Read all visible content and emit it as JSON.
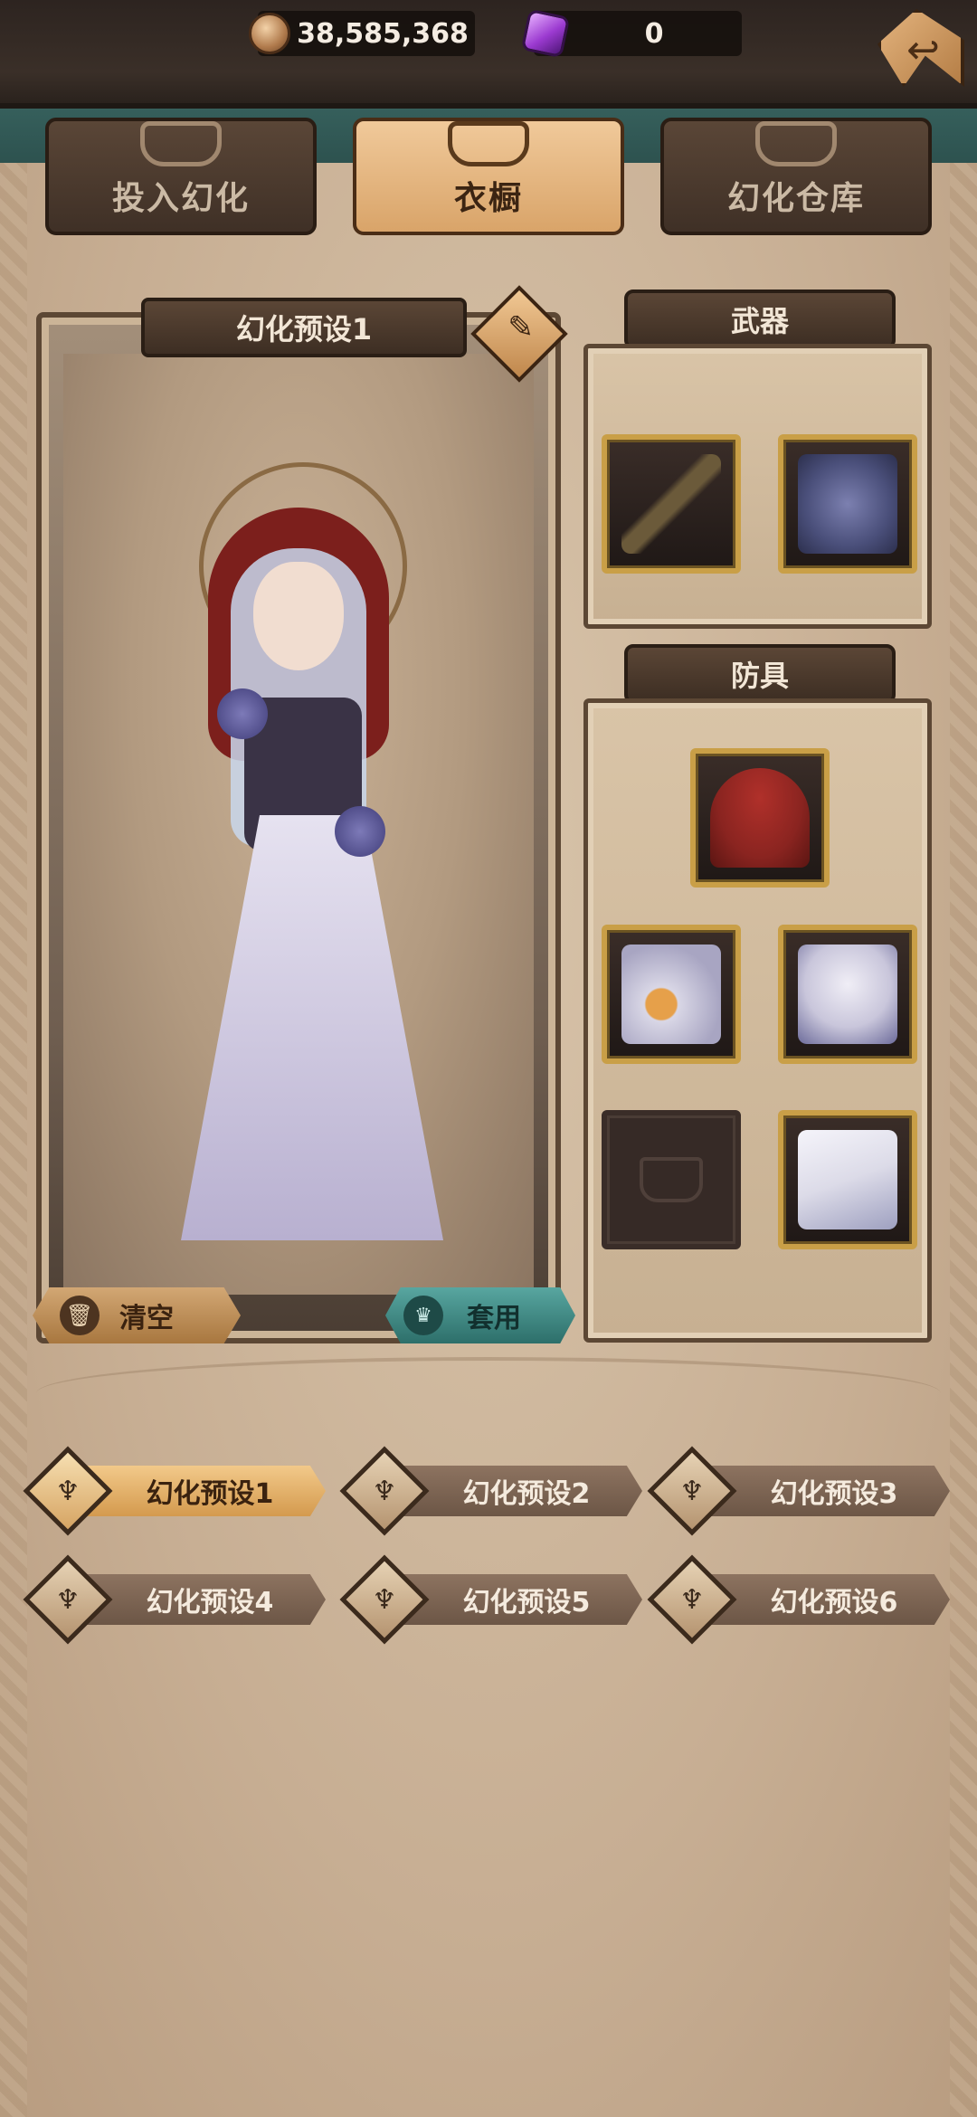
{
  "currencies": [
    {
      "name": "coin-icon",
      "value": "38,585,368"
    },
    {
      "name": "gem-icon",
      "value": "0"
    }
  ],
  "tabs": [
    {
      "label": "投入幻化",
      "icon": "mask-icon",
      "active": false
    },
    {
      "label": "衣橱",
      "icon": "armor-icon",
      "active": true
    },
    {
      "label": "幻化仓库",
      "icon": "cabinet-icon",
      "active": false
    }
  ],
  "character": {
    "preset_title": "幻化预设1",
    "clear_label": "清空",
    "apply_label": "套用"
  },
  "weapons": {
    "title": "武器",
    "slots": [
      {
        "item": "flower-staff-icon",
        "color": "#6b5a3a"
      },
      {
        "item": "shield-icon",
        "color": "#4a4f7a"
      }
    ]
  },
  "armor": {
    "title": "防具",
    "slots": [
      {
        "item": "red-cape-icon",
        "color": "#8a2420",
        "empty": false
      },
      {
        "item": "gloves-icon",
        "color": "#d9d7e6",
        "empty": false
      },
      {
        "item": "chest-armor-icon",
        "color": "#c9c6db",
        "empty": false
      },
      {
        "item": "pants-slot-empty-icon",
        "color": "#362a26",
        "empty": true
      },
      {
        "item": "boots-icon",
        "color": "#dcdbe8",
        "empty": false
      }
    ]
  },
  "presets": [
    {
      "label": "幻化预设1",
      "active": true
    },
    {
      "label": "幻化预设2",
      "active": false
    },
    {
      "label": "幻化预设3",
      "active": false
    },
    {
      "label": "幻化预设4",
      "active": false
    },
    {
      "label": "幻化预设5",
      "active": false
    },
    {
      "label": "幻化预设6",
      "active": false
    }
  ]
}
